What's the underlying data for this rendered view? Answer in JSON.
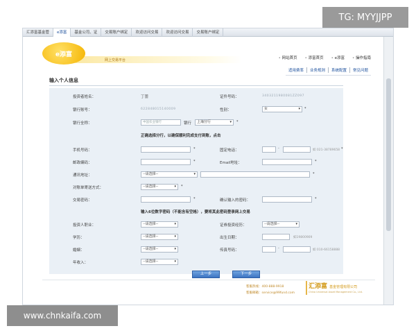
{
  "watermarks": {
    "tg": "TG: MYYJJPP",
    "site": "www.chnkaifa.com"
  },
  "tabs": [
    "汇添富基金管",
    "e添富",
    "基金公司、证",
    "交易账户绑定",
    "欢迎访问交易",
    "欢迎访问交易",
    "交易账户绑定"
  ],
  "logo": {
    "text": "e添富",
    "slogan": "网上交易平台"
  },
  "top_links": [
    "网站首页",
    "添富首页",
    "e添富",
    "操作指南"
  ],
  "sub_links": [
    "适用费率",
    "业务规则",
    "系统配置",
    "常见问题"
  ],
  "form": {
    "title": "输入个人信息",
    "investor_name_label": "投资者姓名：",
    "investor_name_value": "丁蕾",
    "id_number_label": "证件号码：",
    "id_number_value": "3403211980081ZZ097",
    "bank_account_label": "银行账号：",
    "bank_account_value": "622848015140009",
    "gender_label": "性别：",
    "gender_value": "女",
    "bank_name_label": "银行全称：",
    "bank_name_placeholder": "中国农业银行",
    "branch_label": "银行",
    "branch_value": "上海分行",
    "notice_branch": "正确选择分行，以确保顺利完成支付到账，点击",
    "mobile_label": "手机号码：",
    "phone_label": "固定电话：",
    "phone_hint": "如 021-38789658",
    "postcode_label": "邮政编码：",
    "email_label": "Email地址：",
    "address_label": "通讯地址：",
    "address_select": "--请选择--",
    "statement_label": "对账单寄送方式：",
    "statement_select": "--请选择--",
    "trade_pwd_label": "交易密码：",
    "confirm_pwd_label": "确认输入的密码：",
    "notice_pwd": "输入6位数字密码（不能含有空格），要将其此密码登录网上交易",
    "occupation_label": "投资人职业：",
    "occupation_select": "--请选择--",
    "experience_label": "证券投资经历：",
    "experience_select": "--请选择--",
    "education_label": "学历：",
    "education_select": "--请选择--",
    "birth_label": "出生日期：",
    "birth_hint": "如19800909",
    "marital_label": "婚姻：",
    "marital_select": "--请选择--",
    "fax_label": "传真号码：",
    "fax_hint": "如 010-66158888",
    "income_label": "年收入：",
    "income_select": "--请选择--",
    "prev_button": "上一步",
    "next_button": "下一步"
  },
  "footer": {
    "hotline": "客服热线：400-888-9918",
    "email": "客服邮箱：service@99fund.com",
    "logo": "汇添富",
    "logo_cn": "基金管理有限公司",
    "logo_en": "China Universal Asset Management Co., Ltd."
  }
}
